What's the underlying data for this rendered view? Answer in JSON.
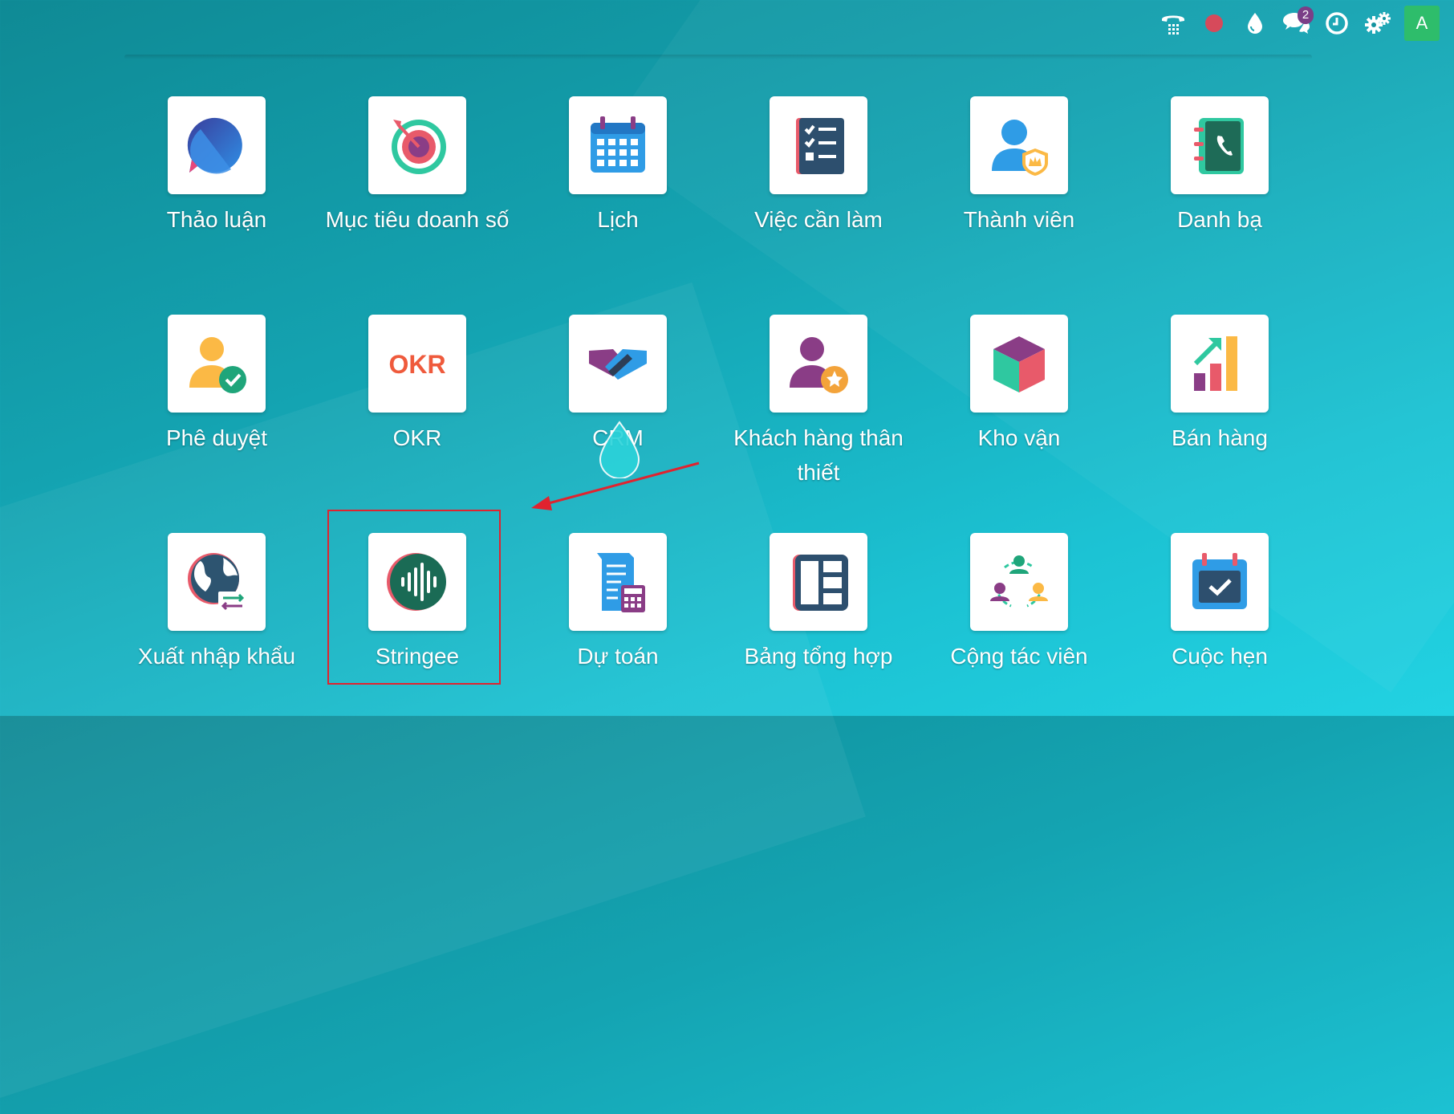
{
  "systray": {
    "icons": [
      "phone-icon",
      "recording-dot-icon",
      "water-drop-icon",
      "chat-icon",
      "clock-icon",
      "gears-icon"
    ],
    "chat_badge": "2",
    "avatar_letter": "A",
    "colors": {
      "avatar": "#2ebd6b",
      "badge": "#7a3f87",
      "recording": "#d64a5b"
    }
  },
  "apps": {
    "thao_luan": "Thảo luận",
    "muc_tieu": "Mục tiêu doanh số",
    "lich": "Lịch",
    "viec_can_lam": "Việc cần làm",
    "thanh_vien": "Thành viên",
    "danh_ba": "Danh bạ",
    "phe_duyet": "Phê duyệt",
    "okr": "OKR",
    "crm": "CRM",
    "khach_hang": "Khách hàng thân thiết",
    "kho_van": "Kho vận",
    "ban_hang": "Bán hàng",
    "xuat_nhap_khau": "Xuất nhập khẩu",
    "stringee": "Stringee",
    "du_toan": "Dự toán",
    "bang_tong_hop": "Bảng tổng hợp",
    "cong_tac_vien": "Cộng tác viên",
    "cuoc_hen": "Cuộc hẹn"
  },
  "okr_logo_text": "OKR",
  "annotation": {
    "color": "#e0232f",
    "highlighted_app": "Stringee"
  }
}
